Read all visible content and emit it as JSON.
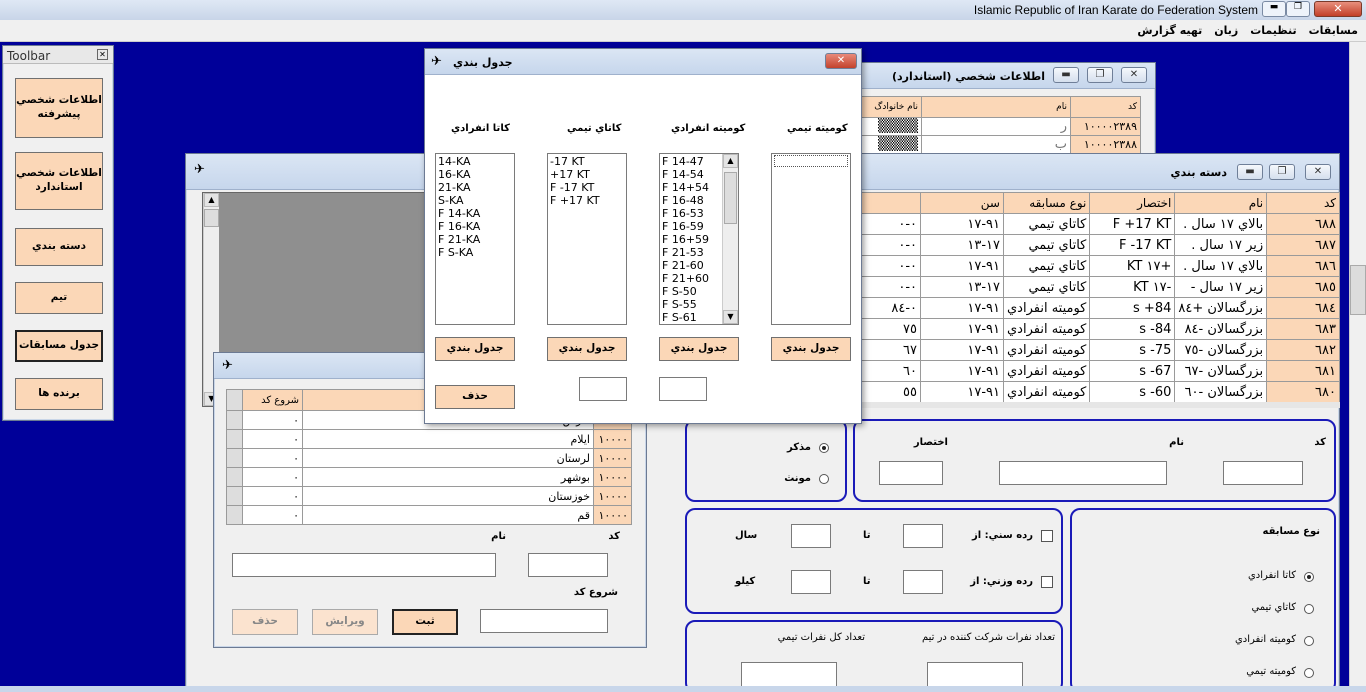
{
  "app": {
    "title": "Islamic Republic of Iran Karate do Federation System",
    "menu": [
      "مسابقات",
      "تنظيمات",
      "زبان",
      "تهيه گزارش"
    ]
  },
  "toolbar": {
    "title": "Toolbar",
    "buttons": [
      "اطلاعات شخصي پيشرفته",
      "اطلاعات شخصي استاندارد",
      "دسته بندي",
      "تيم",
      "جدول مسابقات",
      "برنده ها"
    ]
  },
  "personal": {
    "title": "اطلاعات شخصي (استاندارد)",
    "columns": [
      "کد",
      "نام",
      "نام خانوادگ"
    ],
    "rows": [
      [
        "١٠٠٠٠٢٣٨٩",
        "ر"
      ],
      [
        "١٠٠٠٠٢٣٨٨",
        "ب"
      ]
    ]
  },
  "schedule": {
    "title": "جدول بندي",
    "columns": [
      {
        "title": "کوميته تيمي",
        "items": [],
        "button": "جدول بندي"
      },
      {
        "title": "کوميته انفرادي",
        "items": [
          "F 14-47",
          "F 14-54",
          "F 14+54",
          "F 16-48",
          "F 16-53",
          "F 16-59",
          "F 16+59",
          "F 21-53",
          "F 21-60",
          "F 21+60",
          "F S-50",
          "F S-55",
          "F S-61"
        ],
        "button": "جدول بندي"
      },
      {
        "title": "کاتاي تيمي",
        "items": [
          "-17 KT",
          "+17 KT",
          "F -17 KT",
          "F +17 KT"
        ],
        "button": "جدول بندي"
      },
      {
        "title": "کاتا انفرادي",
        "items": [
          "14-KA",
          "16-KA",
          "21-KA",
          "S-KA",
          "F 14-KA",
          "F 16-KA",
          "F 21-KA",
          "F S-KA"
        ],
        "button": "جدول بندي"
      }
    ],
    "delete": "حذف"
  },
  "category": {
    "title": "دسته بندي",
    "columns": [
      "کد",
      "نام",
      "اختصار",
      "نوع مسابقه",
      "سن"
    ],
    "rows": [
      [
        "٦٨٨",
        "بالاي ١٧ سال .",
        "F +17 KT",
        "کاتاي تيمي",
        "٩١-١٧",
        "٠-٠"
      ],
      [
        "٦٨٧",
        "زير ١٧ سال .",
        "F -17 KT",
        "کاتاي تيمي",
        "١٧-١٣",
        "٠-٠"
      ],
      [
        "٦٨٦",
        "بالاي ١٧ سال .",
        "KT ١٧+",
        "کاتاي تيمي",
        "٩١-١٧",
        "٠-٠"
      ],
      [
        "٦٨٥",
        "زير ١٧ سال -",
        "KT ١٧-",
        "کاتاي تيمي",
        "١٧-١٣",
        "٠-٠"
      ],
      [
        "٦٨٤",
        "بزرگسالان +٨٤",
        "s +84",
        "کوميته انفرادي",
        "٩١-١٧",
        "٠-٨٤"
      ],
      [
        "٦٨٣",
        "بزرگسالان -٨٤",
        "s -84",
        "کوميته انفرادي",
        "٩١-١٧",
        "٧٥"
      ],
      [
        "٦٨٢",
        "بزرگسالان -٧٥",
        "s -75",
        "کوميته انفرادي",
        "٩١-١٧",
        "٦٧"
      ],
      [
        "٦٨١",
        "بزرگسالان -٦٧",
        "s -67",
        "کوميته انفرادي",
        "٩١-١٧",
        "٦٠"
      ],
      [
        "٦٨٠",
        "بزرگسالان -٦٠",
        "s -60",
        "کوميته انفرادي",
        "٩١-١٧",
        "٥٥"
      ]
    ],
    "code_label": "کد",
    "name_label": "نام",
    "abbr_label": "اختصار",
    "male": "مذکر",
    "female": "مونث",
    "age_row": "رده سني: از",
    "weight_row": "رده وزني: از",
    "to": "تا",
    "year": "سال",
    "kilo": "کيلو",
    "comp_type": "نوع مسابقه",
    "types": [
      "کاتا انفرادي",
      "کاتاي تيمي",
      "کوميته انفرادي",
      "کوميته تيمي"
    ],
    "team_participants": "تعداد نفرات شرکت کننده در تيم",
    "team_total": "تعداد کل نفرات تيمي"
  },
  "team": {
    "columns": [
      "نام",
      "شروع کد"
    ],
    "rows": [
      [
        "فارس",
        "٠",
        "١٠٠٠٠"
      ],
      [
        "ايلام",
        "٠",
        "١٠٠٠٠"
      ],
      [
        "لرستان",
        "٠",
        "١٠٠٠٠"
      ],
      [
        "بوشهر",
        "٠",
        "١٠٠٠٠"
      ],
      [
        "خوزستان",
        "٠",
        "١٠٠٠٠"
      ],
      [
        "قم",
        "٠",
        "١٠٠٠٠"
      ]
    ],
    "code_label": "کد",
    "name_label": "نام",
    "start_label": "شروع کد",
    "save": "ثبت",
    "edit": "ويرايش",
    "delete": "حذف"
  }
}
